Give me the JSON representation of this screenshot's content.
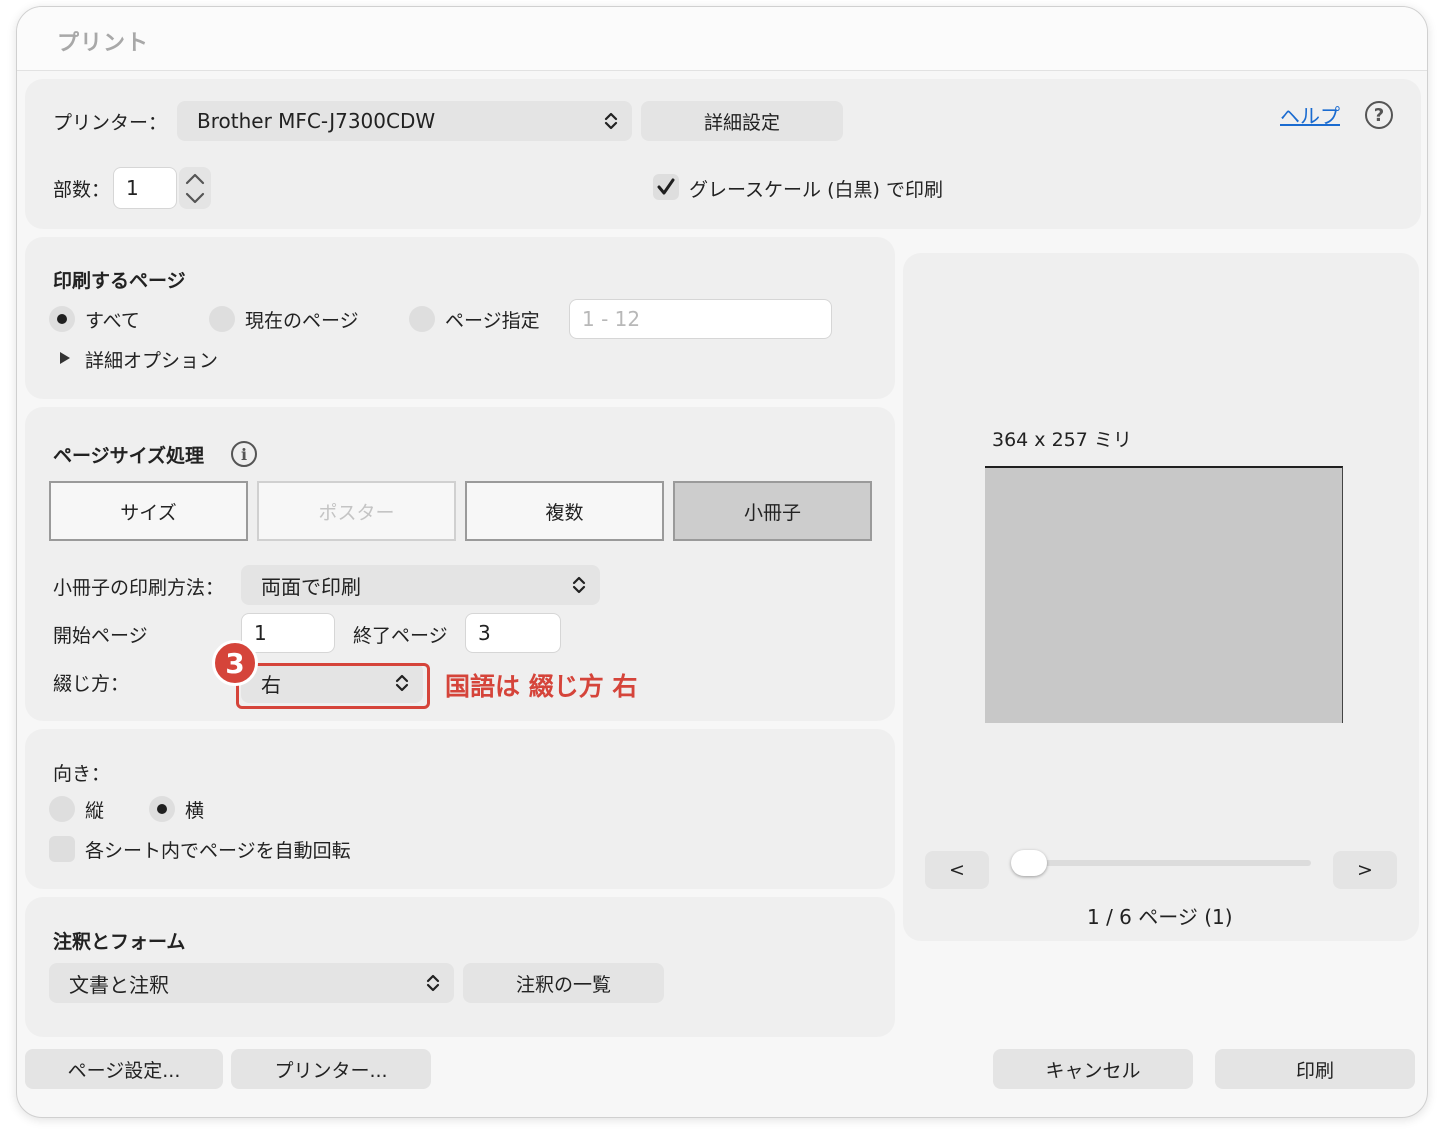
{
  "window": {
    "title": "プリント"
  },
  "printer": {
    "label": "プリンター：",
    "selected": "Brother MFC-J7300CDW",
    "details_button": "詳細設定",
    "help_link": "ヘルプ",
    "help_icon": "?"
  },
  "copies": {
    "label": "部数：",
    "value": "1"
  },
  "grayscale": {
    "label": "グレースケール (白黒) で印刷",
    "checked": true
  },
  "pages": {
    "heading": "印刷するページ",
    "options": [
      {
        "label": "すべて",
        "selected": true
      },
      {
        "label": "現在のページ",
        "selected": false
      },
      {
        "label": "ページ指定",
        "selected": false
      }
    ],
    "range_placeholder": "1 - 12",
    "advanced": "詳細オプション"
  },
  "page_size": {
    "heading": "ページサイズ処理",
    "info_icon": "i",
    "tabs": [
      {
        "label": "サイズ",
        "state": "normal"
      },
      {
        "label": "ポスター",
        "state": "disabled"
      },
      {
        "label": "複数",
        "state": "normal"
      },
      {
        "label": "小冊子",
        "state": "selected"
      }
    ],
    "booklet_method_label": "小冊子の印刷方法：",
    "booklet_method_value": "両面で印刷",
    "start_page_label": "開始ページ",
    "start_page_value": "1",
    "end_page_label": "終了ページ",
    "end_page_value": "3",
    "binding_label": "綴じ方：",
    "binding_value": "右"
  },
  "annotation": {
    "step": "3",
    "note": "国語は 綴じ方 右",
    "color": "#d5443a"
  },
  "orientation": {
    "heading": "向き：",
    "options": [
      {
        "label": "縦",
        "selected": false
      },
      {
        "label": "横",
        "selected": true
      }
    ],
    "auto_rotate": {
      "label": "各シート内でページを自動回転",
      "checked": false
    }
  },
  "comments": {
    "heading": "注釈とフォーム",
    "selected": "文書と注釈",
    "list_button": "注釈の一覧"
  },
  "preview": {
    "size_label": "364 x 257 ミリ",
    "prev_button": "<",
    "next_button": ">",
    "page_indicator": "1 / 6 ページ (1)",
    "slider_position": 0
  },
  "footer": {
    "page_setup": "ページ設定...",
    "printer_button": "プリンター...",
    "cancel": "キャンセル",
    "print": "印刷"
  }
}
